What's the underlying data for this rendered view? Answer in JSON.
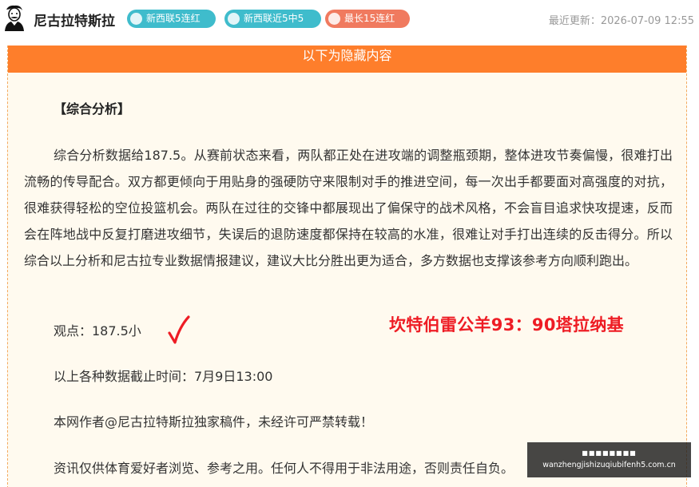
{
  "header": {
    "author_name": "尼古拉特斯拉",
    "badges": [
      {
        "label": "新西联5连红",
        "color": "#3fbccc"
      },
      {
        "label": "新西联近5中5",
        "color": "#3fbccc"
      },
      {
        "label": "最长15连红",
        "color": "#f07a5f"
      }
    ],
    "updated_label": "最近更新：",
    "updated_time": "2026-07-09 12:55"
  },
  "hidden_section": {
    "bar_label": "以下为隐藏内容",
    "bar_color": "#fe7e2b",
    "title": "【综合分析】",
    "analysis": "综合分析数据给187.5。从赛前状态来看，两队都正处在进攻端的调整瓶颈期，整体进攻节奏偏慢，很难打出流畅的传导配合。双方都更倾向于用贴身的强硬防守来限制对手的推进空间，每一次出手都要面对高强度的对抗，很难获得轻松的空位投篮机会。两队在过往的交锋中都展现出了偏保守的战术风格，不会盲目追求快攻提速，反而会在阵地战中反复打磨进攻细节，失误后的退防速度都保持在较高的水准，很难让对手打出连续的反击得分。所以综合以上分析和尼古拉专业数据情报建议，建议大比分胜出更为适合，多方数据也支撑该参考方向顺利跑出。",
    "viewpoint": "观点：187.5小",
    "check_mark": "√",
    "result": "坎特伯雷公羊93：90塔拉纳基",
    "cutoff": "以上各种数据截止时间：7月9日13:00",
    "copyright": "本网作者@尼古拉特斯拉独家稿件，未经许可严禁转载！",
    "disclaimer": "资讯仅供体育爱好者浏览、参考之用。任何人不得用于非法用途，否则责任自负。"
  },
  "watermark": {
    "top_text": "■■■■■■■■",
    "url": "wanzhengjishizuqiubifenh5.com.cn"
  },
  "colors": {
    "accent_orange": "#fe7e2b",
    "result_red": "#ee1c24",
    "badge_teal": "#3fbccc",
    "badge_red": "#f07a5f"
  }
}
